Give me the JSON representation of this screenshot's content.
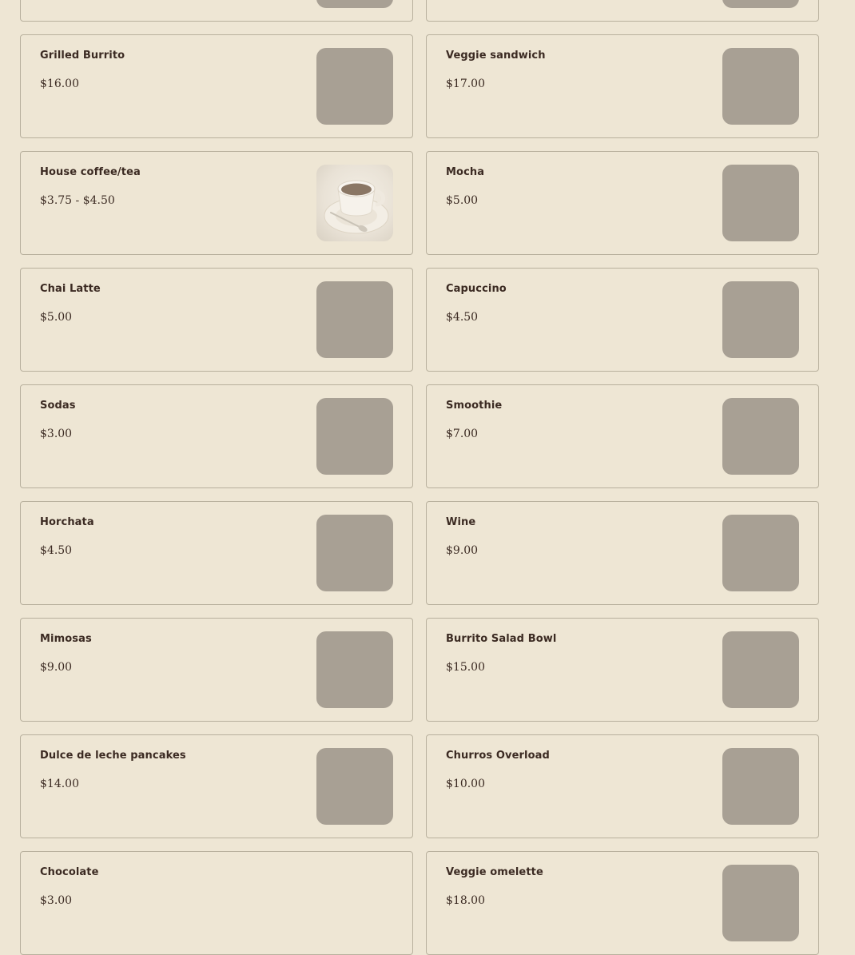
{
  "menu": {
    "items": [
      {
        "name": "",
        "price": "",
        "image": "placeholder"
      },
      {
        "name": "",
        "price": "",
        "image": "placeholder"
      },
      {
        "name": "Grilled Burrito",
        "price": "$16.00",
        "image": "placeholder"
      },
      {
        "name": "Veggie sandwich",
        "price": "$17.00",
        "image": "placeholder"
      },
      {
        "name": "House coffee/tea",
        "price": "$3.75 - $4.50",
        "image": "coffee-cup-photo"
      },
      {
        "name": "Mocha",
        "price": "$5.00",
        "image": "placeholder"
      },
      {
        "name": "Chai Latte",
        "price": "$5.00",
        "image": "placeholder"
      },
      {
        "name": "Capuccino",
        "price": "$4.50",
        "image": "placeholder"
      },
      {
        "name": "Sodas",
        "price": "$3.00",
        "image": "placeholder"
      },
      {
        "name": "Smoothie",
        "price": "$7.00",
        "image": "placeholder"
      },
      {
        "name": "Horchata",
        "price": "$4.50",
        "image": "placeholder"
      },
      {
        "name": "Wine",
        "price": "$9.00",
        "image": "placeholder"
      },
      {
        "name": "Mimosas",
        "price": "$9.00",
        "image": "placeholder"
      },
      {
        "name": "Burrito Salad Bowl",
        "price": "$15.00",
        "image": "placeholder"
      },
      {
        "name": "Dulce de leche pancakes",
        "price": "$14.00",
        "image": "placeholder"
      },
      {
        "name": "Churros Overload",
        "price": "$10.00",
        "image": "placeholder"
      },
      {
        "name": "Chocolate",
        "price": "$3.00",
        "image": "none"
      },
      {
        "name": "Veggie omelette",
        "price": "$18.00",
        "image": "placeholder"
      }
    ]
  },
  "colors": {
    "background": "#EEE6D4",
    "card_border": "#B8B09D",
    "text": "#3B2A22",
    "image_placeholder": "#A8A094"
  }
}
